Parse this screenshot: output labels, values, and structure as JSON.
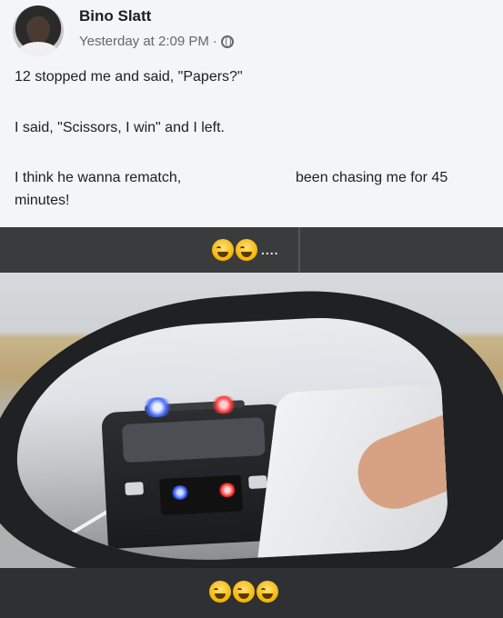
{
  "post": {
    "author": "Bino Slatt",
    "timestamp": "Yesterday at 2:09 PM",
    "separator": "·",
    "privacy_icon": "globe-icon",
    "lines": [
      "12 stopped me and said, \"Papers?\"",
      "I said, \"Scissors, I win\" and I left.",
      "I think he wanna rematch,",
      "been chasing me for 45",
      "minutes!"
    ]
  },
  "caption_top": {
    "emojis": [
      "laughing-crying-emoji",
      "laughing-crying-emoji"
    ],
    "suffix": "...."
  },
  "caption_bottom": {
    "emojis": [
      "laughing-crying-emoji",
      "laughing-crying-emoji",
      "laughing-crying-emoji"
    ]
  },
  "colors": {
    "background": "#f4f5f7",
    "caption_bar": "#3a3b3d",
    "text": "#1c1e21",
    "meta_text": "#65676b"
  }
}
